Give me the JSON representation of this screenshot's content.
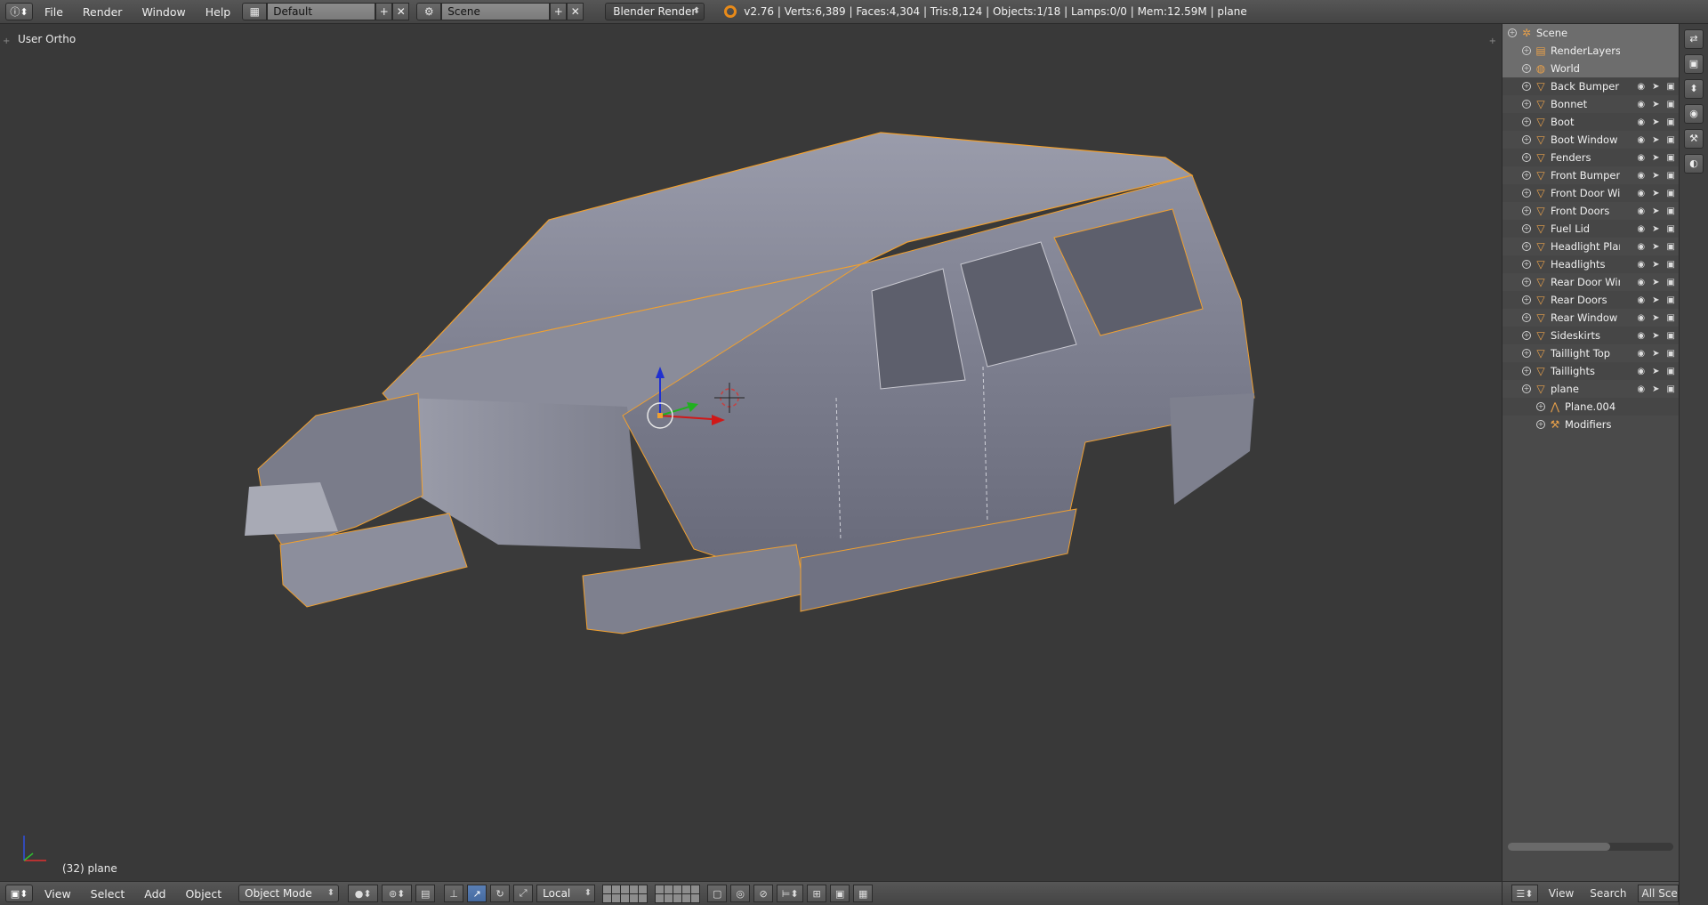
{
  "header": {
    "editor_icon": "info-icon",
    "menus": [
      "File",
      "Render",
      "Window",
      "Help"
    ],
    "layout": "Default",
    "scene": "Scene",
    "render_engine": "Blender Render",
    "stats": "v2.76 | Verts:6,389 | Faces:4,304 | Tris:8,124 | Objects:1/18 | Lamps:0/0 | Mem:12.59M | plane"
  },
  "viewport": {
    "view_label": "User Ortho",
    "object_label": "(32) plane"
  },
  "footer": {
    "menus": [
      "View",
      "Select",
      "Add",
      "Object"
    ],
    "mode": "Object Mode",
    "pivot": "Local"
  },
  "outliner": {
    "rows": [
      {
        "name": "Scene",
        "icon": "scene-icon",
        "depth": 0
      },
      {
        "name": "RenderLayers",
        "icon": "renderlayers-icon",
        "depth": 1
      },
      {
        "name": "World",
        "icon": "world-icon",
        "depth": 1
      },
      {
        "name": "Back Bumper",
        "icon": "mesh-object-icon",
        "depth": 1
      },
      {
        "name": "Bonnet",
        "icon": "mesh-object-icon",
        "depth": 1
      },
      {
        "name": "Boot",
        "icon": "mesh-object-icon",
        "depth": 1
      },
      {
        "name": "Boot Window",
        "icon": "mesh-object-icon",
        "depth": 1
      },
      {
        "name": "Fenders",
        "icon": "mesh-object-icon",
        "depth": 1
      },
      {
        "name": "Front Bumper",
        "icon": "mesh-object-icon",
        "depth": 1
      },
      {
        "name": "Front Door Winc",
        "icon": "mesh-object-icon",
        "depth": 1
      },
      {
        "name": "Front Doors",
        "icon": "mesh-object-icon",
        "depth": 1
      },
      {
        "name": "Fuel Lid",
        "icon": "mesh-object-icon",
        "depth": 1
      },
      {
        "name": "Headlight Plane",
        "icon": "mesh-object-icon",
        "depth": 1
      },
      {
        "name": "Headlights",
        "icon": "mesh-object-icon",
        "depth": 1
      },
      {
        "name": "Rear Door Winc",
        "icon": "mesh-object-icon",
        "depth": 1
      },
      {
        "name": "Rear Doors",
        "icon": "mesh-object-icon",
        "depth": 1
      },
      {
        "name": "Rear Window",
        "icon": "mesh-object-icon",
        "depth": 1
      },
      {
        "name": "Sideskirts",
        "icon": "mesh-object-icon",
        "depth": 1
      },
      {
        "name": "Taillight Top",
        "icon": "mesh-object-icon",
        "depth": 1
      },
      {
        "name": "Taillights",
        "icon": "mesh-object-icon",
        "depth": 1
      },
      {
        "name": "plane",
        "icon": "mesh-object-icon",
        "depth": 1
      },
      {
        "name": "Plane.004",
        "icon": "mesh-data-icon",
        "depth": 2
      },
      {
        "name": "Modifiers",
        "icon": "wrench-icon",
        "depth": 2
      }
    ],
    "footer_view": "View",
    "footer_search": "Search",
    "footer_scenes": "All Scenes"
  },
  "colors": {
    "selection_outline": "#f0a030",
    "viewport_bg": "#393939",
    "car_body": "#8d8f9e"
  }
}
